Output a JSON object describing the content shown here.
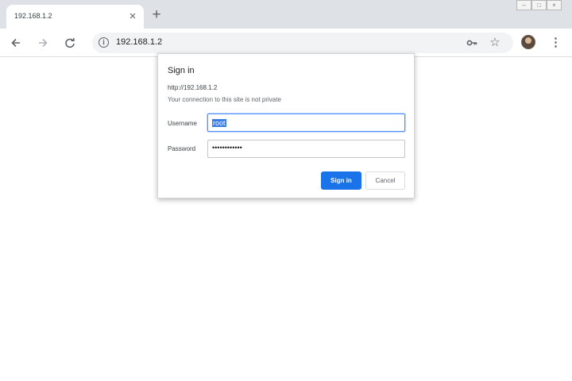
{
  "tab": {
    "title": "192.168.1.2",
    "close_glyph": "×",
    "new_tab_glyph": "+"
  },
  "window_controls": [
    {
      "name": "minimize",
      "glyph": "–"
    },
    {
      "name": "maximize",
      "glyph": "□"
    },
    {
      "name": "close",
      "glyph": "×"
    }
  ],
  "toolbar": {
    "back_icon": "arrow-back-icon",
    "forward_icon": "arrow-forward-icon",
    "reload_icon": "reload-icon",
    "url": "192.168.1.2",
    "icons": [
      "info-icon",
      "key-icon",
      "star-icon",
      "avatar",
      "menu-icon"
    ]
  },
  "dialog": {
    "title": "Sign in",
    "origin": "http://192.168.1.2",
    "warning": "Your connection to this site is not private",
    "username_label": "Username",
    "username_value": "root",
    "password_label": "Password",
    "password_mask": "••••••••••••",
    "sign_in_label": "Sign in",
    "cancel_label": "Cancel"
  },
  "colors": {
    "primary_button": "#1a73e8",
    "focus_ring": "#4d90fe",
    "tabstrip": "#dee1e6"
  }
}
